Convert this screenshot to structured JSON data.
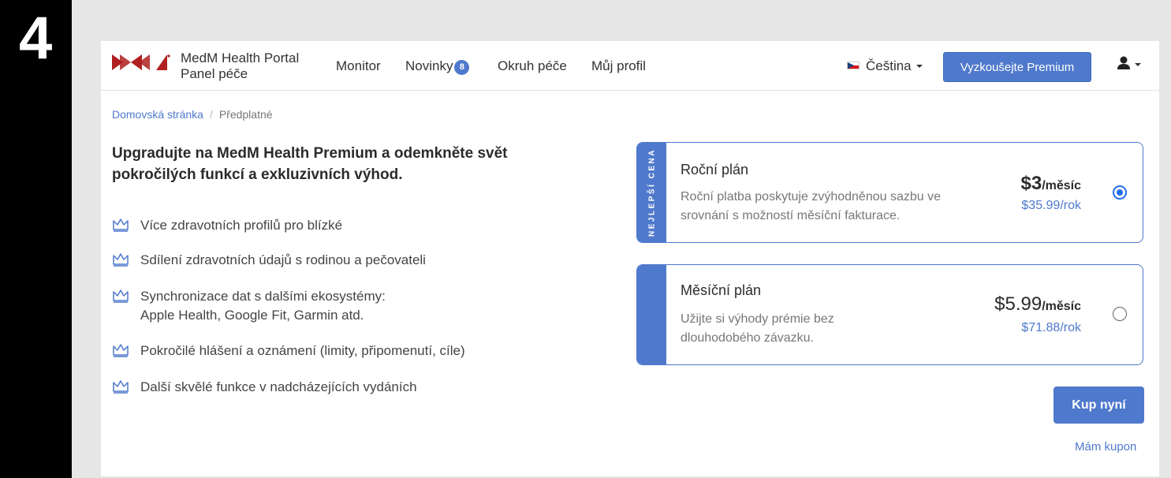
{
  "step": {
    "number": "4"
  },
  "navbar": {
    "brand_line1": "MedM Health Portal",
    "brand_line2": "Panel péče",
    "items": [
      {
        "label": "Monitor"
      },
      {
        "label": "Novinky",
        "badge": "8"
      },
      {
        "label": "Okruh péče"
      },
      {
        "label": "Můj profil"
      }
    ],
    "language": "Čeština",
    "premium_button": "Vyzkoušejte Premium"
  },
  "breadcrumb": {
    "home": "Domovská stránka",
    "separator": "/",
    "current": "Předplatné"
  },
  "headline": "Upgradujte na MedM Health Premium a odemkněte svět pokročilých funkcí a exkluzivních výhod.",
  "features": [
    {
      "icon": "crown-icon",
      "line1": "Více zdravotních profilů pro blízké"
    },
    {
      "icon": "crown-icon",
      "line1": "Sdílení zdravotních údajů s rodinou a pečovateli"
    },
    {
      "icon": "crown-icon",
      "line1": "Synchronizace dat s dalšími ekosystémy:",
      "line2": "Apple Health, Google Fit, Garmin atd."
    },
    {
      "icon": "crown-icon",
      "line1": "Pokročilé hlášení a oznámení (limity, připomenutí, cíle)"
    },
    {
      "icon": "crown-icon",
      "line1": "Další skvělé funkce v nadcházejících vydáních"
    }
  ],
  "plans": [
    {
      "ribbon": "NEJLEPŠÍ CENA",
      "title": "Roční plán",
      "desc_line1": "Roční platba poskytuje zvýhodněnou sazbu ve",
      "desc_line2": "srovnání s možností měsíční fakturace.",
      "price": "$3",
      "per": "/měsíc",
      "yearly": "$35.99/rok",
      "selected": true
    },
    {
      "title": "Měsíční plán",
      "desc_line1": "Užijte si výhody prémie bez",
      "desc_line2": "dlouhodobého závazku.",
      "price": "$5.99",
      "per": "/měsíc",
      "yearly": "$71.88/rok",
      "selected": false
    }
  ],
  "buy_button": "Kup nyní",
  "coupon_link": "Mám kupon",
  "colors": {
    "accent": "#4f79cc",
    "step_bar": "#000000",
    "background": "#e6e6e6"
  }
}
